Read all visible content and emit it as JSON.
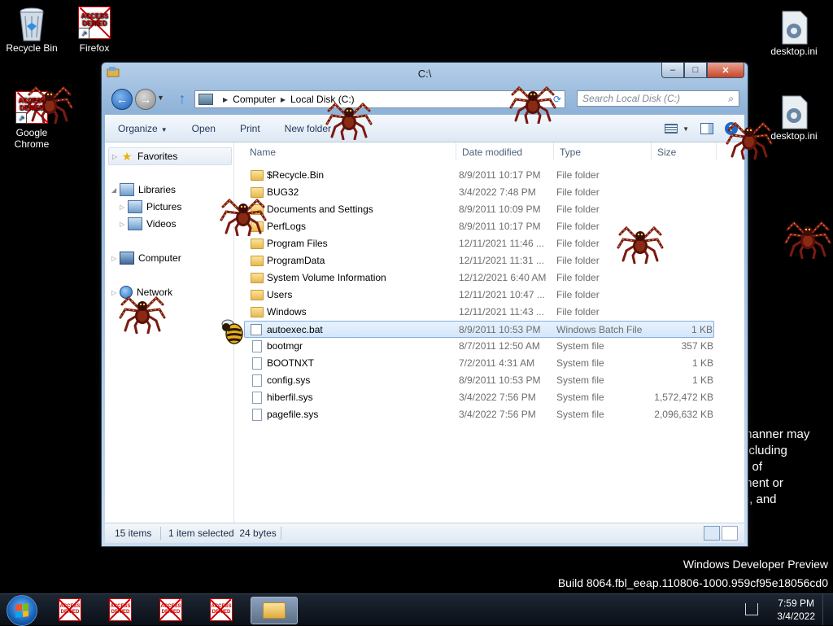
{
  "desktop": {
    "icons": [
      {
        "label": "Recycle Bin"
      },
      {
        "label": "Firefox",
        "overlay": "ACCESS DENIED"
      },
      {
        "label": "Google Chrome",
        "overlay": "ACCESS DENIED"
      },
      {
        "label": "desktop.ini"
      },
      {
        "label": "desktop.ini"
      }
    ],
    "side_text": [
      "manner may",
      "ncluding",
      "e of",
      "ment or",
      "f), and"
    ],
    "watermark_line1": "Windows Developer Preview",
    "watermark_line2": "Build 8064.fbl_eeap.110806-1000.959cf95e18056cd0"
  },
  "window": {
    "title": "C:\\",
    "caption_buttons": {
      "minimize": "–",
      "maximize": "□",
      "close": "✕"
    },
    "address": {
      "crumbs": [
        "Computer",
        "Local Disk (C:)"
      ]
    },
    "search": {
      "placeholder": "Search Local Disk (C:)"
    },
    "toolbar": {
      "organize": "Organize",
      "open": "Open",
      "print": "Print",
      "new_folder": "New folder"
    },
    "nav": {
      "favorites": "Favorites",
      "libraries": "Libraries",
      "pictures": "Pictures",
      "videos": "Videos",
      "computer": "Computer",
      "network": "Network"
    },
    "columns": {
      "name": "Name",
      "date": "Date modified",
      "type": "Type",
      "size": "Size"
    },
    "files": [
      {
        "name": "$Recycle.Bin",
        "date": "8/9/2011 10:17 PM",
        "type": "File folder",
        "size": "",
        "kind": "folder"
      },
      {
        "name": "BUG32",
        "date": "3/4/2022 7:48 PM",
        "type": "File folder",
        "size": "",
        "kind": "folder"
      },
      {
        "name": "Documents and Settings",
        "date": "8/9/2011 10:09 PM",
        "type": "File folder",
        "size": "",
        "kind": "folder"
      },
      {
        "name": "PerfLogs",
        "date": "8/9/2011 10:17 PM",
        "type": "File folder",
        "size": "",
        "kind": "folder"
      },
      {
        "name": "Program Files",
        "date": "12/11/2021 11:46 ...",
        "type": "File folder",
        "size": "",
        "kind": "folder"
      },
      {
        "name": "ProgramData",
        "date": "12/11/2021 11:31 ...",
        "type": "File folder",
        "size": "",
        "kind": "folder"
      },
      {
        "name": "System Volume Information",
        "date": "12/12/2021 6:40 AM",
        "type": "File folder",
        "size": "",
        "kind": "folder"
      },
      {
        "name": "Users",
        "date": "12/11/2021 10:47 ...",
        "type": "File folder",
        "size": "",
        "kind": "folder"
      },
      {
        "name": "Windows",
        "date": "12/11/2021 11:43 ...",
        "type": "File folder",
        "size": "",
        "kind": "folder"
      },
      {
        "name": "autoexec.bat",
        "date": "8/9/2011 10:53 PM",
        "type": "Windows Batch File",
        "size": "1 KB",
        "kind": "bat",
        "selected": true
      },
      {
        "name": "bootmgr",
        "date": "8/7/2011 12:50 AM",
        "type": "System file",
        "size": "357 KB",
        "kind": "file"
      },
      {
        "name": "BOOTNXT",
        "date": "7/2/2011 4:31 AM",
        "type": "System file",
        "size": "1 KB",
        "kind": "file"
      },
      {
        "name": "config.sys",
        "date": "8/9/2011 10:53 PM",
        "type": "System file",
        "size": "1 KB",
        "kind": "file"
      },
      {
        "name": "hiberfil.sys",
        "date": "3/4/2022 7:56 PM",
        "type": "System file",
        "size": "1,572,472 KB",
        "kind": "file"
      },
      {
        "name": "pagefile.sys",
        "date": "3/4/2022 7:56 PM",
        "type": "System file",
        "size": "2,096,632 KB",
        "kind": "file"
      }
    ],
    "status": {
      "count": "15 items",
      "selection": "1 item selected  24 bytes"
    }
  },
  "taskbar": {
    "denied_label": "ACCESS DENIED",
    "clock_time": "7:59 PM",
    "clock_date": "3/4/2022"
  },
  "colors": {
    "accent": "#1a5fb4",
    "denied": "#cc0000",
    "selection": "#d3e6fb"
  }
}
